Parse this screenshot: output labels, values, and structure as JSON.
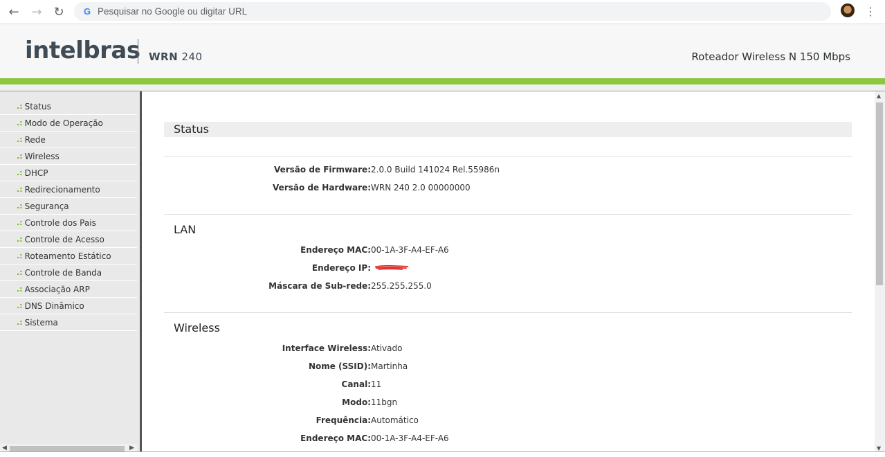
{
  "browser": {
    "omnibox_placeholder": "Pesquisar no Google ou digitar URL",
    "google_letter": "G"
  },
  "header": {
    "logo": "intelbras",
    "model_bold": "WRN",
    "model_num": "240",
    "title": "Roteador Wireless N 150 Mbps",
    "accent_color": "#8dc63f"
  },
  "sidebar": {
    "bullet": ".:",
    "items": [
      {
        "label": "Status"
      },
      {
        "label": "Modo de Operação"
      },
      {
        "label": "Rede"
      },
      {
        "label": "Wireless"
      },
      {
        "label": "DHCP"
      },
      {
        "label": "Redirecionamento"
      },
      {
        "label": "Segurança"
      },
      {
        "label": "Controle dos Pais"
      },
      {
        "label": "Controle de Acesso"
      },
      {
        "label": "Roteamento Estático"
      },
      {
        "label": "Controle de Banda"
      },
      {
        "label": "Associação ARP"
      },
      {
        "label": "DNS Dinâmico"
      },
      {
        "label": "Sistema"
      }
    ]
  },
  "main": {
    "page_title": "Status",
    "firmware": {
      "label": "Versão de Firmware:",
      "value": "2.0.0 Build 141024 Rel.55986n"
    },
    "hardware": {
      "label": "Versão de Hardware:",
      "value": "WRN 240 2.0 00000000"
    },
    "lan": {
      "title": "LAN",
      "mac": {
        "label": "Endereço MAC:",
        "value": "00-1A-3F-A4-EF-A6"
      },
      "ip": {
        "label": "Endereço IP:"
      },
      "mask": {
        "label": "Máscara de Sub-rede:",
        "value": "255.255.255.0"
      }
    },
    "wireless": {
      "title": "Wireless",
      "interface": {
        "label": "Interface Wireless:",
        "value": "Ativado"
      },
      "ssid": {
        "label": "Nome (SSID):",
        "value": "Martinha"
      },
      "channel": {
        "label": "Canal:",
        "value": "11"
      },
      "mode": {
        "label": "Modo:",
        "value": "11bgn"
      },
      "frequency": {
        "label": "Frequência:",
        "value": "Automático"
      },
      "mac": {
        "label": "Endereço MAC:",
        "value": "00-1A-3F-A4-EF-A6"
      }
    }
  }
}
